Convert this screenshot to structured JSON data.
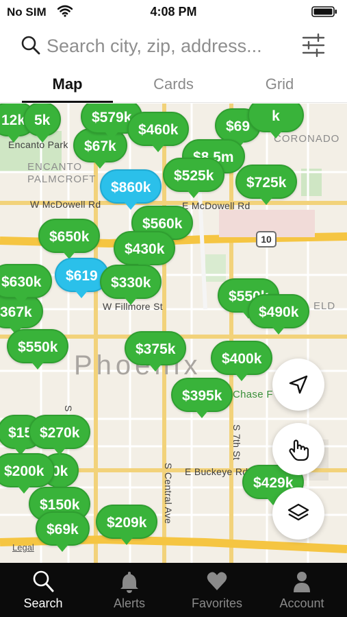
{
  "status_bar": {
    "carrier": "No SIM",
    "time": "4:08 PM"
  },
  "search": {
    "placeholder": "Search city, zip, address..."
  },
  "tabs": [
    {
      "label": "Map",
      "active": true
    },
    {
      "label": "Cards",
      "active": false
    },
    {
      "label": "Grid",
      "active": false
    }
  ],
  "map": {
    "labels": {
      "encanto_park": "Encanto Park",
      "encanto_palmcroft": "ENCANTO\nPALMCROFT",
      "coronado": "CORONADO",
      "w_mcdowell": "W McDowell Rd",
      "e_mcdowell": "E McDowell Rd",
      "route_10": "10",
      "w_fillmore": "W Fillmore St",
      "phoenix": "Phoenix",
      "chase_field": "Chase F",
      "s_7th_ave": "S 7th Ave",
      "s_7th_st": "S 7th St",
      "s_central_ave": "S Central Ave",
      "e_buckeye": "E Buckeye Rd",
      "field_suffix": "ELD"
    },
    "pins": [
      {
        "label": "12k",
        "highlighted": false
      },
      {
        "label": "5k",
        "highlighted": false
      },
      {
        "label": "$579k",
        "highlighted": false
      },
      {
        "label": "$460k",
        "highlighted": false
      },
      {
        "label": "$67k",
        "highlighted": false
      },
      {
        "label": "$69",
        "highlighted": false
      },
      {
        "label": "k",
        "highlighted": false
      },
      {
        "label": "$8.5m",
        "highlighted": false
      },
      {
        "label": "$525k",
        "highlighted": false
      },
      {
        "label": "$860k",
        "highlighted": true
      },
      {
        "label": "$725k",
        "highlighted": false
      },
      {
        "label": "$560k",
        "highlighted": false
      },
      {
        "label": "$650k",
        "highlighted": false
      },
      {
        "label": "$430k",
        "highlighted": false
      },
      {
        "label": "$619",
        "highlighted": true
      },
      {
        "label": "$630k",
        "highlighted": false
      },
      {
        "label": "$330k",
        "highlighted": false
      },
      {
        "label": "$550k",
        "highlighted": false
      },
      {
        "label": "367k",
        "highlighted": false
      },
      {
        "label": "$490k",
        "highlighted": false
      },
      {
        "label": "$550k",
        "highlighted": false
      },
      {
        "label": "$375k",
        "highlighted": false
      },
      {
        "label": "$400k",
        "highlighted": false
      },
      {
        "label": "$395k",
        "highlighted": false
      },
      {
        "label": "$15",
        "highlighted": false
      },
      {
        "label": "$270k",
        "highlighted": false
      },
      {
        "label": "0k",
        "highlighted": false
      },
      {
        "label": "$200k",
        "highlighted": false
      },
      {
        "label": "$150k",
        "highlighted": false
      },
      {
        "label": "$429k",
        "highlighted": false
      },
      {
        "label": "$69k",
        "highlighted": false
      },
      {
        "label": "$209k",
        "highlighted": false
      }
    ],
    "legal": "Legal",
    "buttons": {
      "locate": "location-arrow-icon",
      "draw": "hand-pointer-icon",
      "layers": "layers-icon"
    }
  },
  "bottom_nav": [
    {
      "label": "Search",
      "icon": "search-icon",
      "active": true
    },
    {
      "label": "Alerts",
      "icon": "bell-icon",
      "active": false
    },
    {
      "label": "Favorites",
      "icon": "heart-icon",
      "active": false
    },
    {
      "label": "Account",
      "icon": "person-icon",
      "active": false
    }
  ],
  "colors": {
    "pin_green": "#39b33a",
    "pin_blue": "#2bc0ea",
    "nav_bg": "#0b0b0b"
  }
}
